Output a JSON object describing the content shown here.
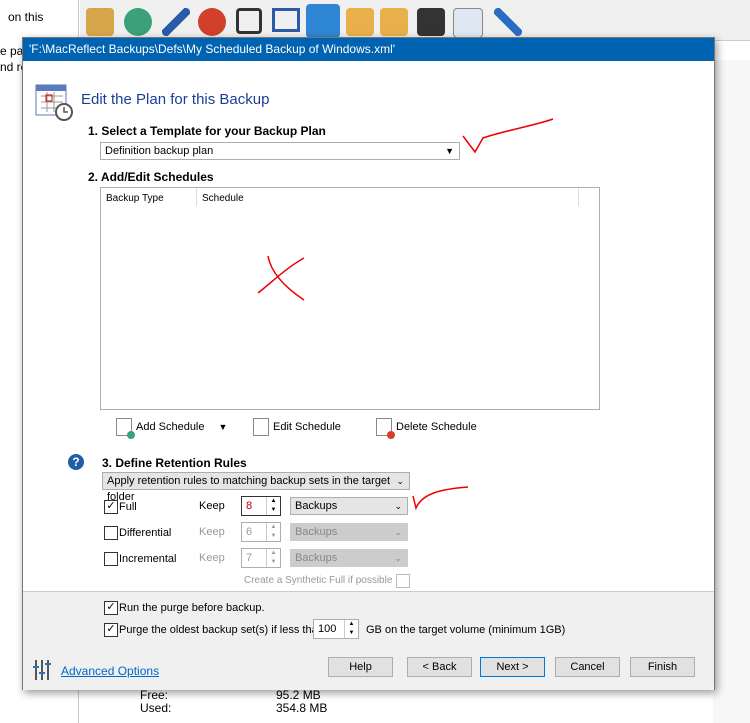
{
  "background": {
    "left_text": [
      "on this",
      "e pa",
      "nd re"
    ],
    "free_label": "Free:",
    "free_value": "95.2 MB",
    "used_label": "Used:",
    "used_value": "354.8 MB"
  },
  "dialog": {
    "title": "'F:\\MacReflect Backups\\Defs\\My Scheduled Backup of Windows.xml'",
    "heading": "Edit the Plan for this Backup",
    "section1": "1. Select a Template for your Backup Plan",
    "template": "Definition backup plan",
    "section2": "2. Add/Edit Schedules",
    "columns": [
      "Backup Type",
      "Schedule"
    ],
    "add_schedule": "Add Schedule",
    "edit_schedule": "Edit Schedule",
    "delete_schedule": "Delete Schedule",
    "section3": "3. Define Retention Rules",
    "retention_mode": "Apply retention rules to matching backup sets in the target folder",
    "rules": [
      {
        "label": "Full",
        "checked": true,
        "keep": "Keep",
        "value": "8",
        "unit": "Backups",
        "enabled": true
      },
      {
        "label": "Differential",
        "checked": false,
        "keep": "Keep",
        "value": "6",
        "unit": "Backups",
        "enabled": false
      },
      {
        "label": "Incremental",
        "checked": false,
        "keep": "Keep",
        "value": "7",
        "unit": "Backups",
        "enabled": false
      }
    ],
    "synthetic_full": "Create a Synthetic Full if possible",
    "run_purge": "Run the purge before backup.",
    "purge_oldest": "Purge the oldest backup set(s) if less than",
    "purge_value": "100",
    "purge_suffix": "GB on the target volume (minimum 1GB)",
    "advanced": "Advanced Options",
    "buttons": {
      "help": "Help",
      "back": "< Back",
      "next": "Next >",
      "cancel": "Cancel",
      "finish": "Finish"
    }
  },
  "colors": {
    "titlebar": "#0063b1",
    "heading": "#1b3f96",
    "annotation": "#e00000"
  }
}
